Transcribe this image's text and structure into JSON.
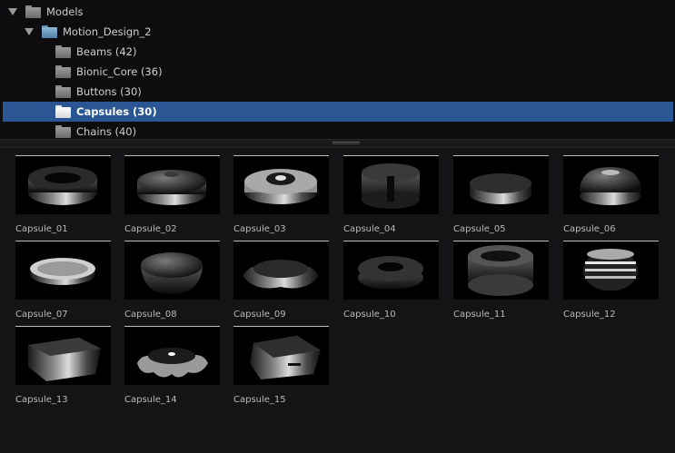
{
  "tree": {
    "items": [
      {
        "label": "Models",
        "level": 0,
        "expanded": true,
        "selected": false,
        "folder": "grey"
      },
      {
        "label": "Motion_Design_2",
        "level": 1,
        "expanded": true,
        "selected": false,
        "folder": "blue"
      },
      {
        "label": "Beams (42)",
        "level": 2,
        "expanded": false,
        "selected": false,
        "folder": "grey"
      },
      {
        "label": "Bionic_Core (36)",
        "level": 2,
        "expanded": false,
        "selected": false,
        "folder": "grey"
      },
      {
        "label": "Buttons (30)",
        "level": 2,
        "expanded": false,
        "selected": false,
        "folder": "grey"
      },
      {
        "label": "Capsules (30)",
        "level": 2,
        "expanded": false,
        "selected": true,
        "folder": "open"
      },
      {
        "label": "Chains (40)",
        "level": 2,
        "expanded": false,
        "selected": false,
        "folder": "grey"
      }
    ]
  },
  "assets": [
    {
      "name": "Capsule_01",
      "shape": "ring"
    },
    {
      "name": "Capsule_02",
      "shape": "disc"
    },
    {
      "name": "Capsule_03",
      "shape": "gear"
    },
    {
      "name": "Capsule_04",
      "shape": "cylinder-dark"
    },
    {
      "name": "Capsule_05",
      "shape": "puck"
    },
    {
      "name": "Capsule_06",
      "shape": "dome"
    },
    {
      "name": "Capsule_07",
      "shape": "flat-disc"
    },
    {
      "name": "Capsule_08",
      "shape": "bowl"
    },
    {
      "name": "Capsule_09",
      "shape": "flower"
    },
    {
      "name": "Capsule_10",
      "shape": "donut"
    },
    {
      "name": "Capsule_11",
      "shape": "drum"
    },
    {
      "name": "Capsule_12",
      "shape": "cage"
    },
    {
      "name": "Capsule_13",
      "shape": "box"
    },
    {
      "name": "Capsule_14",
      "shape": "star"
    },
    {
      "name": "Capsule_15",
      "shape": "triangle"
    }
  ]
}
